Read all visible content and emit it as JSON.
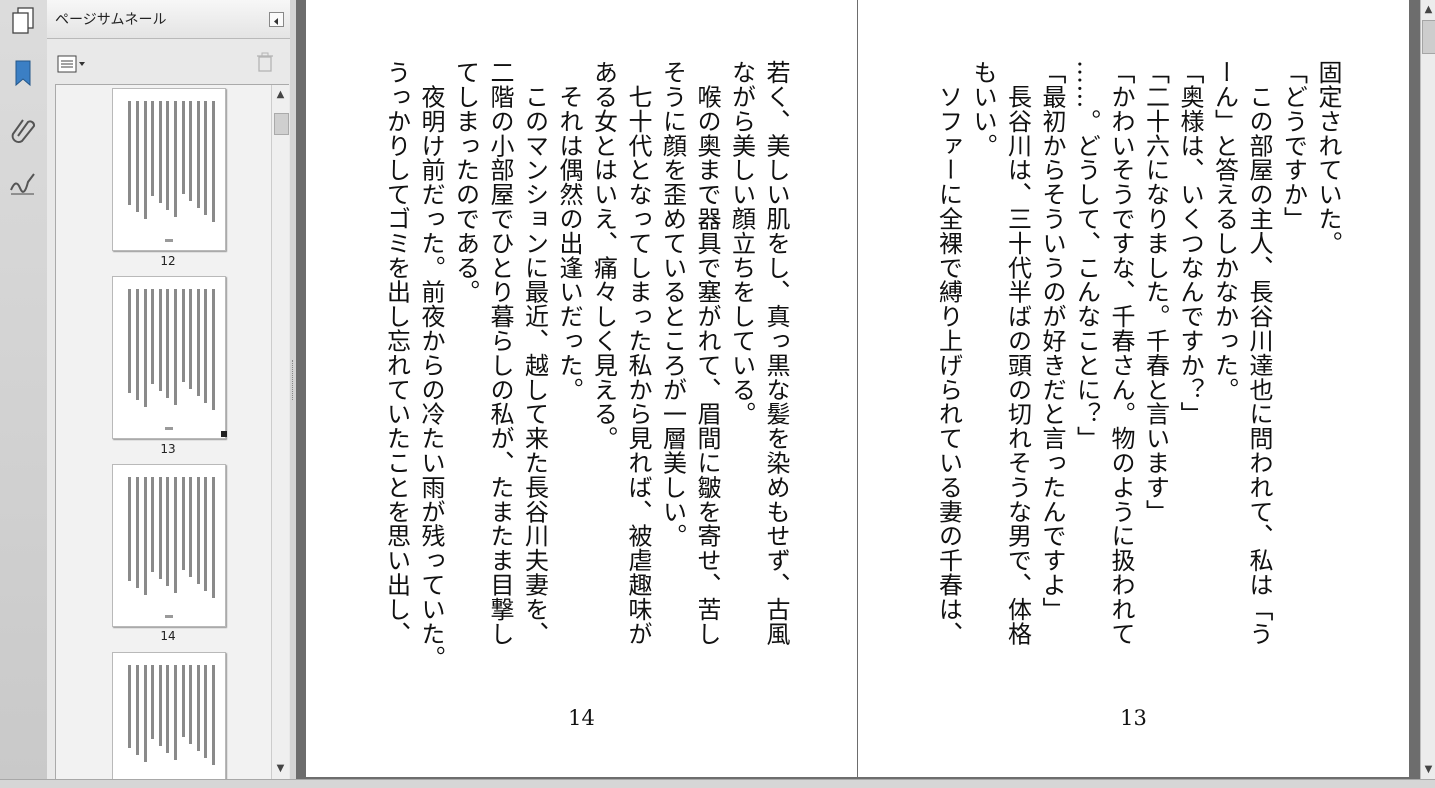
{
  "panel": {
    "title": "ページサムネール",
    "thumbnails": [
      {
        "label": "12"
      },
      {
        "label": "13"
      },
      {
        "label": "14"
      },
      {
        "label": ""
      }
    ]
  },
  "icons": {
    "pages_tool": "pages-icon",
    "bookmarks_tool": "bookmark-icon",
    "attachments_tool": "paperclip-icon",
    "signatures_tool": "signature-icon"
  },
  "colors": {
    "background": "#6d6d6d",
    "page": "#ffffff",
    "text": "#111111",
    "panel": "#e9e9e9",
    "bookmark_accent": "#3b7fc4"
  },
  "page_left": {
    "page_number": "14",
    "lines": [
      "若く、美しい肌をし、真っ黒な髪を染めもせず、古風",
      "ながら美しい顔立ちをしている。",
      "　喉の奥まで器具で塞がれて、眉間に皺を寄せ、苦し",
      "そうに顔を歪めているところが一層美しい。",
      "　七十代となってしまった私から見れば、被虐趣味が",
      "ある女とはいえ、痛々しく見える。",
      "　それは偶然の出逢いだった。",
      "　このマンションに最近、越して来た長谷川夫妻を、",
      "二階の小部屋でひとり暮らしの私が、たまたま目撃し",
      "てしまったのである。",
      "　夜明け前だった。前夜からの冷たい雨が残っていた。",
      "うっかりしてゴミを出し忘れていたことを思い出し、"
    ]
  },
  "page_right": {
    "page_number": "13",
    "lines": [
      "固定されていた。",
      "「どうですか」",
      "　この部屋の主人、長谷川達也に問われて、私は「う",
      "ーん」と答えるしかなかった。",
      "「奥様は、いくつなんですか？」",
      "「二十六になりました。千春と言います」",
      "「かわいそうですな、千春さん。物のように扱われて",
      "……。どうして、こんなことに？」",
      "「最初からそういうのが好きだと言ったんですよ」",
      "　長谷川は、三十代半ばの頭の切れそうな男で、体格",
      "もいい。",
      "　ソファーに全裸で縛り上げられている妻の千春は、"
    ]
  }
}
